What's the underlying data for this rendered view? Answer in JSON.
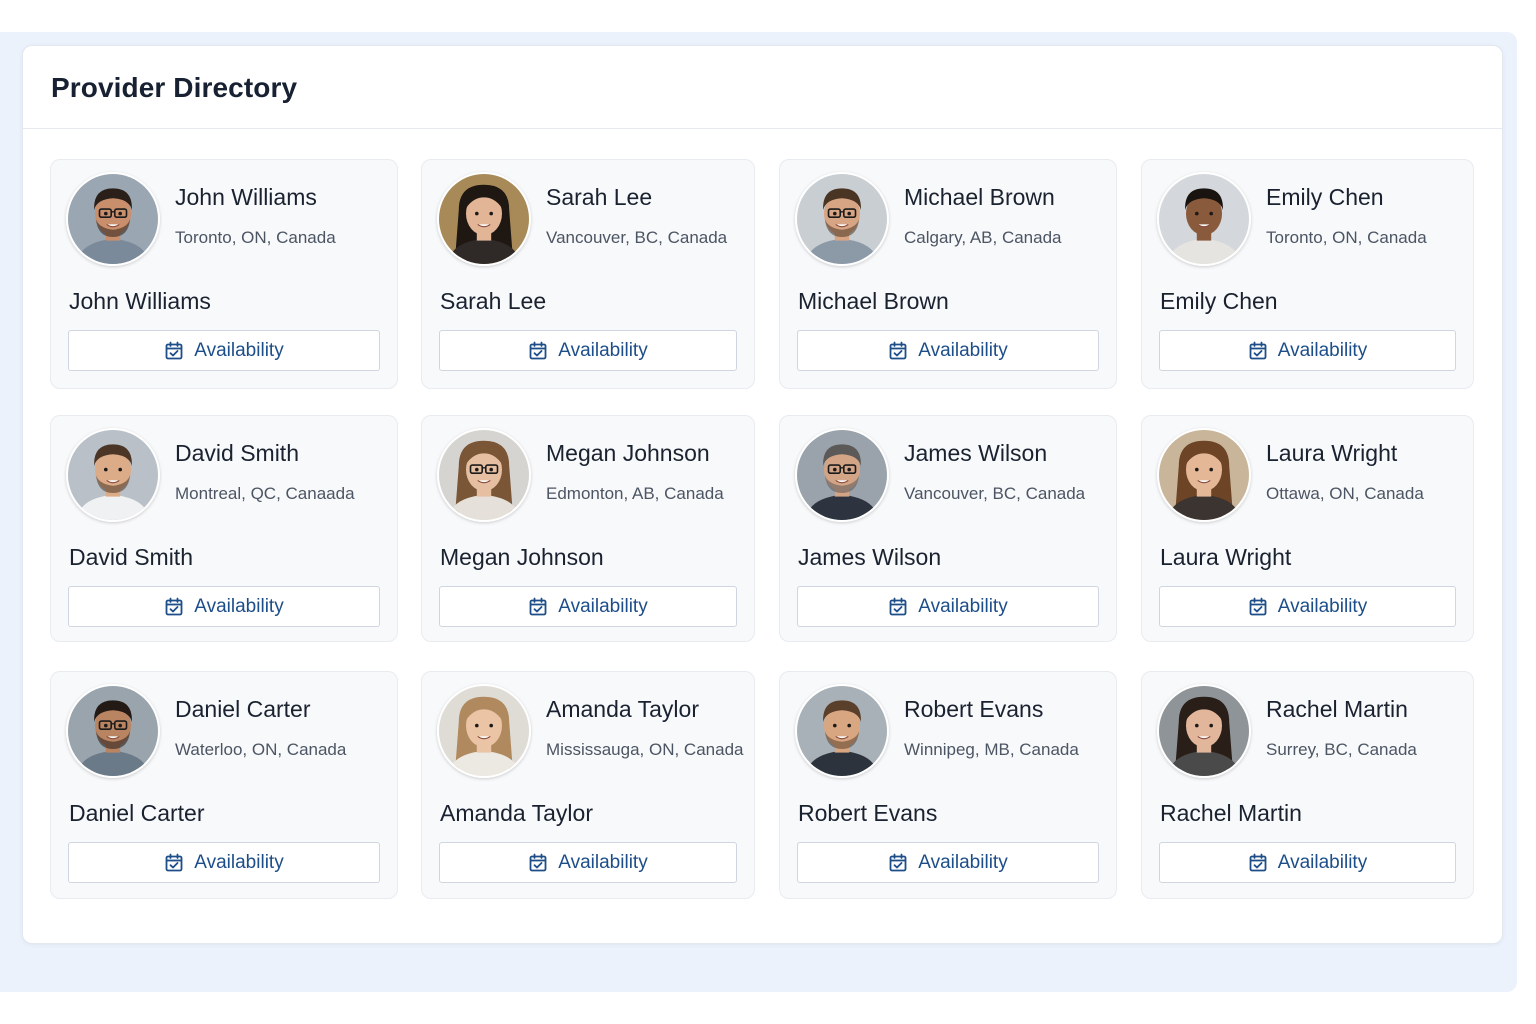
{
  "panel": {
    "title": "Provider Directory"
  },
  "accent_color": "#1d4e89",
  "availability_icon": "calendar-check-icon",
  "providers": [
    {
      "name": "John Williams",
      "location": "Toronto, ON, Canada",
      "button_label": "Availability",
      "avatar": {
        "skin": "#c98f6c",
        "hair": "#2a1f19",
        "shirt": "#7b8a9a",
        "bg": "#9aa6b1",
        "glasses": true,
        "beard": true,
        "long_hair": false
      }
    },
    {
      "name": "Sarah Lee",
      "location": "Vancouver, BC, Canada",
      "button_label": "Availability",
      "avatar": {
        "skin": "#e2b596",
        "hair": "#1e1712",
        "shirt": "#2f2a28",
        "bg": "#a78a58",
        "glasses": false,
        "beard": false,
        "long_hair": true
      }
    },
    {
      "name": "Michael Brown",
      "location": "Calgary, AB, Canada",
      "button_label": "Availability",
      "avatar": {
        "skin": "#d7a583",
        "hair": "#4a3424",
        "shirt": "#8c9aa8",
        "bg": "#c9ced3",
        "glasses": true,
        "beard": true,
        "long_hair": false
      }
    },
    {
      "name": "Emily Chen",
      "location": "Toronto, ON, Canada",
      "button_label": "Availability",
      "avatar": {
        "skin": "#8a5a3c",
        "hair": "#1a1411",
        "shirt": "#e6e4e0",
        "bg": "#d4d8dc",
        "glasses": false,
        "beard": false,
        "long_hair": false
      }
    },
    {
      "name": "David Smith",
      "location": "Montreal, QC, Canaada",
      "button_label": "Availability",
      "avatar": {
        "skin": "#dcab88",
        "hair": "#4b3526",
        "shirt": "#f0f1f3",
        "bg": "#b9c0c7",
        "glasses": false,
        "beard": true,
        "long_hair": false
      }
    },
    {
      "name": "Megan Johnson",
      "location": "Edmonton, AB, Canada",
      "button_label": "Availability",
      "avatar": {
        "skin": "#e6bfa2",
        "hair": "#7a5637",
        "shirt": "#e5e1da",
        "bg": "#d6d4d0",
        "glasses": true,
        "beard": false,
        "long_hair": true
      }
    },
    {
      "name": "James Wilson",
      "location": "Vancouver, BC, Canada",
      "button_label": "Availability",
      "avatar": {
        "skin": "#d3a486",
        "hair": "#5c5a58",
        "shirt": "#2d3440",
        "bg": "#9aa3ab",
        "glasses": true,
        "beard": true,
        "long_hair": false
      }
    },
    {
      "name": "Laura Wright",
      "location": "Ottawa, ON, Canada",
      "button_label": "Availability",
      "avatar": {
        "skin": "#e4b797",
        "hair": "#6e4426",
        "shirt": "#3b3430",
        "bg": "#c8b59a",
        "glasses": false,
        "beard": false,
        "long_hair": true
      }
    },
    {
      "name": "Daniel Carter",
      "location": "Waterloo, ON, Canada",
      "button_label": "Availability",
      "avatar": {
        "skin": "#b98462",
        "hair": "#231a15",
        "shirt": "#6b7a88",
        "bg": "#9aa4ad",
        "glasses": true,
        "beard": true,
        "long_hair": false
      }
    },
    {
      "name": "Amanda Taylor",
      "location": "Mississauga, ON, Canada",
      "button_label": "Availability",
      "avatar": {
        "skin": "#ebc4a6",
        "hair": "#b08a5e",
        "shirt": "#ece8e2",
        "bg": "#dfdcd6",
        "glasses": false,
        "beard": false,
        "long_hair": true
      }
    },
    {
      "name": "Robert Evans",
      "location": "Winnipeg, MB, Canada",
      "button_label": "Availability",
      "avatar": {
        "skin": "#d9a682",
        "hair": "#5a3f2a",
        "shirt": "#2c333c",
        "bg": "#a9b1b8",
        "glasses": false,
        "beard": true,
        "long_hair": false
      }
    },
    {
      "name": "Rachel Martin",
      "location": "Surrey, BC, Canada",
      "button_label": "Availability",
      "avatar": {
        "skin": "#e2b69a",
        "hair": "#2a1e18",
        "shirt": "#4a4a4a",
        "bg": "#8f9498",
        "glasses": false,
        "beard": false,
        "long_hair": true
      }
    }
  ]
}
